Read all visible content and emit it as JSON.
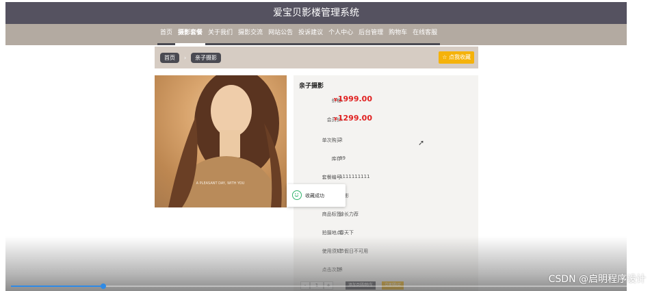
{
  "header": {
    "title": "爱宝贝影楼管理系统"
  },
  "nav": {
    "items": [
      {
        "label": "首页",
        "active": false
      },
      {
        "label": "摄影套餐",
        "active": true
      },
      {
        "label": "关于我们",
        "active": false
      },
      {
        "label": "摄影交流",
        "active": false
      },
      {
        "label": "网站公告",
        "active": false
      },
      {
        "label": "投诉建议",
        "active": false
      },
      {
        "label": "个人中心",
        "active": false
      },
      {
        "label": "后台管理",
        "active": false
      },
      {
        "label": "购物车",
        "active": false
      },
      {
        "label": "在线客服",
        "active": false
      }
    ]
  },
  "breadcrumb": {
    "home": "首页",
    "separator": "›",
    "current": "亲子摄影"
  },
  "favorite_button": "☆ 点我收藏",
  "product": {
    "title": "亲子摄影",
    "image_text": "A PLEASANT DAY, WITH YOU",
    "currency": "¥",
    "fields": [
      {
        "label": "价格:",
        "value": "1999.00",
        "kind": "price"
      },
      {
        "label": "会员价:",
        "value": "1299.00",
        "kind": "price"
      },
      {
        "label": "单次购买:",
        "value": "2",
        "kind": "text"
      },
      {
        "label": "库存:",
        "value": "99",
        "kind": "text"
      },
      {
        "label": "套餐编号:",
        "value": "1111111111",
        "kind": "text"
      },
      {
        "label": "",
        "value": "摄影",
        "kind": "text"
      },
      {
        "label": "商品标签:",
        "value": "徐长力荐",
        "kind": "text"
      },
      {
        "label": "拍摄地点:",
        "value": "春天下",
        "kind": "text"
      },
      {
        "label": "使用须知:",
        "value": "节假日不可用",
        "kind": "text"
      },
      {
        "label": "点击次数:",
        "value": "4",
        "kind": "text"
      }
    ],
    "quantity": "1",
    "minus": "-",
    "plus": "+",
    "add_to_cart": "添加到购物车",
    "buy_now": "立即购买"
  },
  "toast": {
    "text": "收藏成功",
    "icon": "smile-icon",
    "color": "#2fb36b"
  },
  "video": {
    "progress": 0.15
  },
  "watermark": "CSDN @启明程序设计",
  "colors": {
    "accent": "#f5b20a",
    "price": "#e02020",
    "header": "#555260",
    "nav": "#b3aaa1"
  }
}
